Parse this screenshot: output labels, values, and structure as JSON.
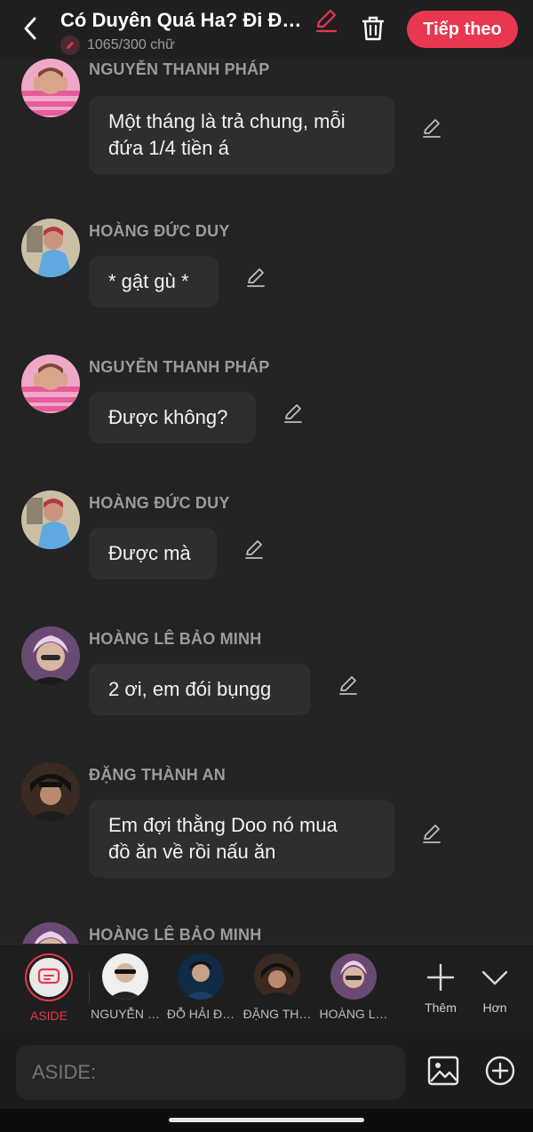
{
  "header": {
    "title": "Có Duyên Quá Ha? Đi Đ…",
    "word_count": "1065/300 chữ",
    "next_label": "Tiếp theo",
    "accent": "#e8374f"
  },
  "messages": [
    {
      "name": "NGUYỄN THANH PHÁP",
      "text_lines": [
        "Một tháng là trả chung, mỗi",
        "đứa 1/4 tiền á"
      ],
      "avatar": "pink-shirt-avatar"
    },
    {
      "name": "HOÀNG ĐỨC DUY",
      "text_lines": [
        "* gật gù *"
      ],
      "avatar": "blue-jacket-avatar"
    },
    {
      "name": "NGUYỄN THANH PHÁP",
      "text_lines": [
        "Được không?"
      ],
      "avatar": "pink-shirt-avatar"
    },
    {
      "name": "HOÀNG ĐỨC DUY",
      "text_lines": [
        "Được mà"
      ],
      "avatar": "blue-jacket-avatar"
    },
    {
      "name": "HOÀNG LÊ BẢO MINH",
      "text_lines": [
        "2 ơi, em đói bụngg"
      ],
      "avatar": "purple-hair-avatar"
    },
    {
      "name": "ĐẶNG THÀNH AN",
      "text_lines": [
        "Em đợi thằng Doo nó mua",
        "đồ ăn về rồi nấu ăn"
      ],
      "avatar": "dark-cap-avatar"
    },
    {
      "name": "HOÀNG LÊ BẢO MINH",
      "text_lines": [],
      "avatar": "purple-hair-avatar"
    }
  ],
  "characters": [
    {
      "label": "ASIDE",
      "selected": true
    },
    {
      "label": "NGUYỄN …"
    },
    {
      "label": "ĐỖ HẢI Đ…"
    },
    {
      "label": "ĐẶNG TH…"
    },
    {
      "label": "HOÀNG L…"
    }
  ],
  "actions": {
    "add_label": "Thêm",
    "more_label": "Hơn"
  },
  "input": {
    "placeholder": "ASIDE:"
  }
}
